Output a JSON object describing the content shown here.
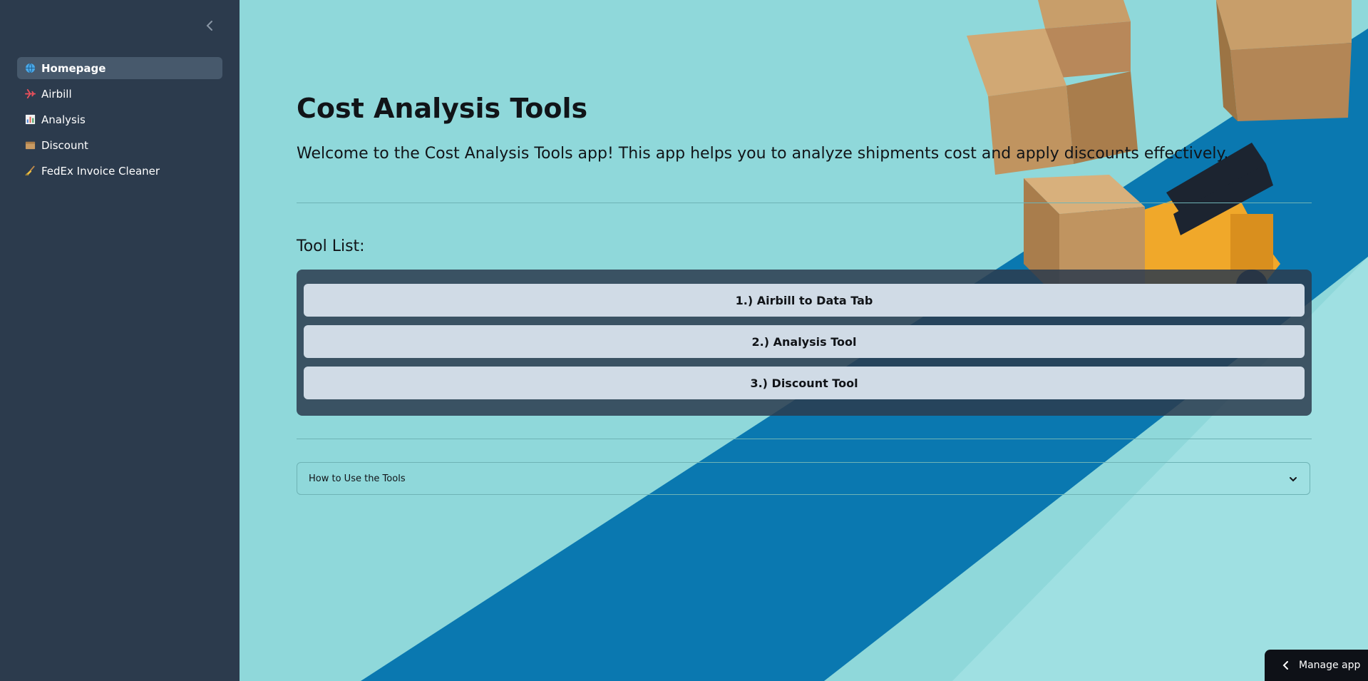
{
  "sidebar": {
    "collapse_icon": "chevron-left-icon",
    "items": [
      {
        "label": "Homepage",
        "icon": "globe-icon",
        "active": true
      },
      {
        "label": "Airbill",
        "icon": "airplane-icon",
        "active": false
      },
      {
        "label": "Analysis",
        "icon": "bar-chart-icon",
        "active": false
      },
      {
        "label": "Discount",
        "icon": "box-icon",
        "active": false
      },
      {
        "label": "FedEx Invoice Cleaner",
        "icon": "broom-icon",
        "active": false
      }
    ]
  },
  "main": {
    "title": "Cost Analysis Tools",
    "subtitle": "Welcome to the Cost Analysis Tools app! This app helps you to analyze shipments cost and apply discounts effectively.",
    "tool_list_label": "Tool List:",
    "tools": [
      {
        "label": "1.) Airbill to Data Tab"
      },
      {
        "label": "2.) Analysis Tool"
      },
      {
        "label": "3.) Discount Tool"
      }
    ],
    "expander_label": "How to Use the Tools"
  },
  "footer": {
    "manage_app_label": "Manage app"
  },
  "colors": {
    "sidebar_bg": "#2c3b4d",
    "active_item_bg": "#47596c",
    "tool_button_bg": "#d0dbe6",
    "background_teal": "#8fd8da",
    "background_blue": "#0a78b0"
  }
}
